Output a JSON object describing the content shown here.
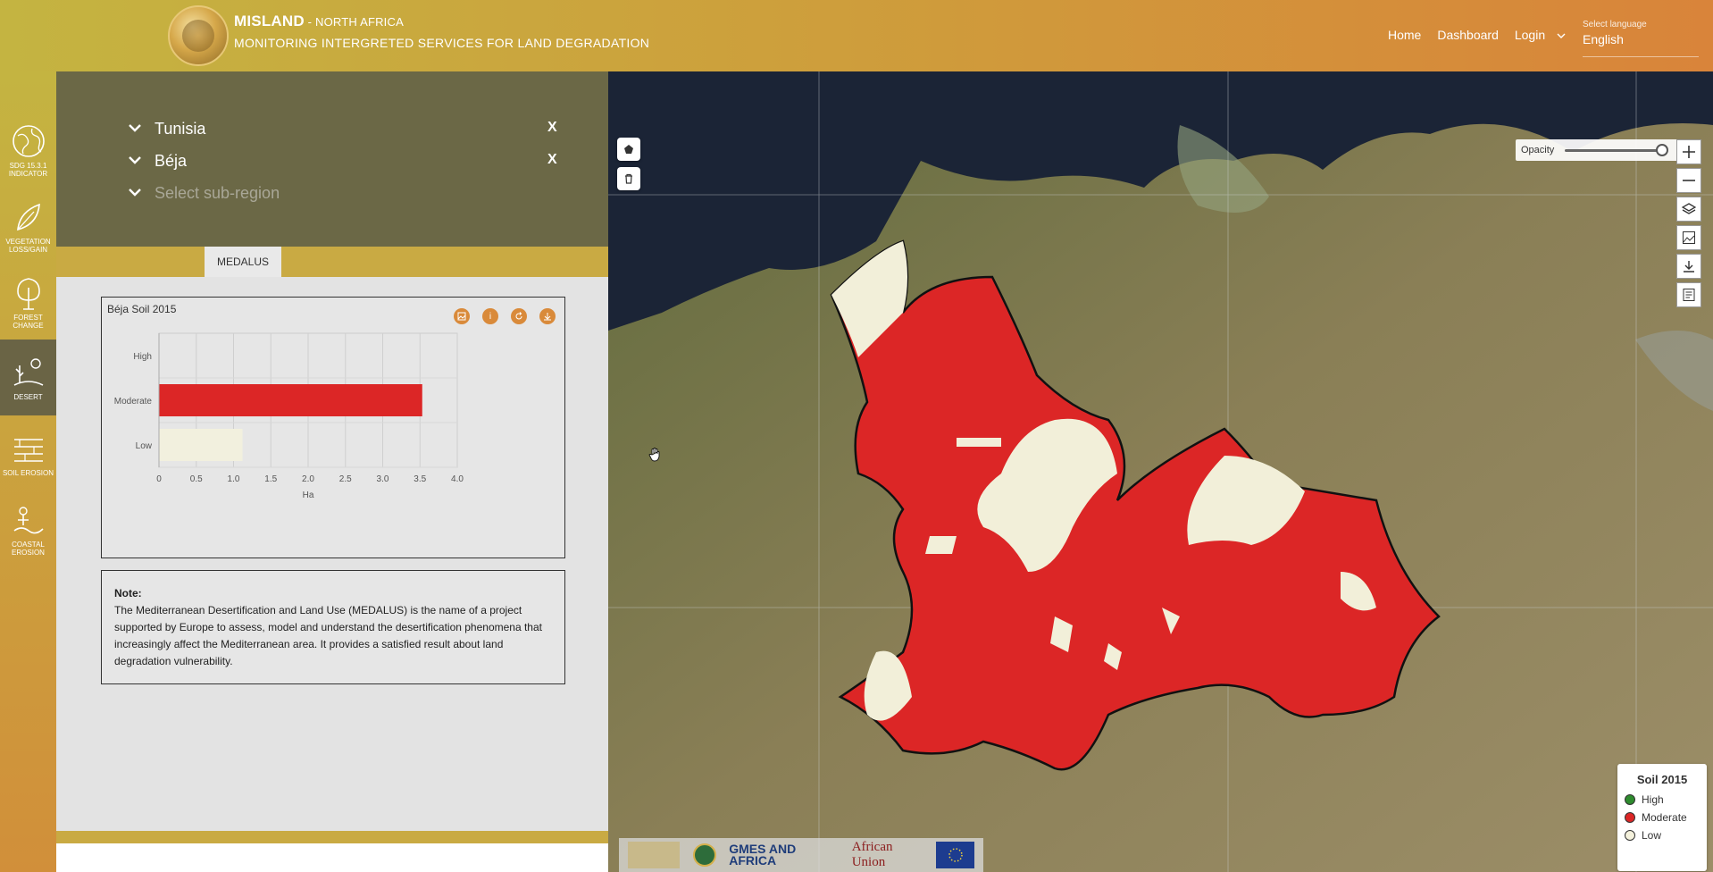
{
  "header": {
    "brand_name": "MISLAND",
    "brand_sub": " - NORTH AFRICA",
    "tagline": "MONITORING INTERGRETED SERVICES FOR LAND DEGRADATION",
    "nav": [
      "Home",
      "Dashboard",
      "Login"
    ],
    "language_label": "Select language",
    "language_value": "English"
  },
  "rail": {
    "items": [
      {
        "label": "SDG 15.3.1 INDICATOR",
        "icon": "globe-icon"
      },
      {
        "label": "VEGETATION LOSS/GAIN",
        "icon": "leaf-icon"
      },
      {
        "label": "FOREST CHANGE",
        "icon": "tree-icon"
      },
      {
        "label": "DESERT",
        "icon": "desert-icon"
      },
      {
        "label": "SOIL EROSION",
        "icon": "soil-icon"
      },
      {
        "label": "COASTAL EROSION",
        "icon": "coast-icon"
      }
    ],
    "active_index": 3
  },
  "selectors": {
    "country": "Tunisia",
    "region": "Béja",
    "subregion_placeholder": "Select sub-region",
    "clear_label": "X"
  },
  "tabs": {
    "active": "MEDALUS"
  },
  "chart_data": {
    "type": "bar",
    "orientation": "horizontal",
    "title": "Béja Soil 2015",
    "categories": [
      "High",
      "Moderate",
      "Low"
    ],
    "values": [
      0,
      3.53,
      1.12
    ],
    "colors": [
      "#2e8b2e",
      "#dc2626",
      "#f2f0de"
    ],
    "xlabel": "Ha",
    "xlim": [
      0,
      4.0
    ],
    "xticks": [
      "0",
      "0.5",
      "1.0",
      "1.5",
      "2.0",
      "2.5",
      "3.0",
      "3.5",
      "4.0"
    ],
    "grid": true
  },
  "note": {
    "title": "Note:",
    "body": "The Mediterranean Desertification and Land Use (MEDALUS) is the name of a project supported by Europe to assess, model and understand the desertification phenomena that increasingly affect the Mediterranean area. It provides a satisfied result about land degradation vulnerability."
  },
  "map": {
    "opacity_label": "Opacity",
    "opacity_value": 1.0,
    "legend_title": "Soil 2015",
    "legend": [
      {
        "label": "High",
        "color": "#2e8b2e"
      },
      {
        "label": "Moderate",
        "color": "#dc2626"
      },
      {
        "label": "Low",
        "color": "#f4f1dc"
      }
    ],
    "partners": [
      "GMES AND AFRICA",
      "African Union"
    ]
  }
}
